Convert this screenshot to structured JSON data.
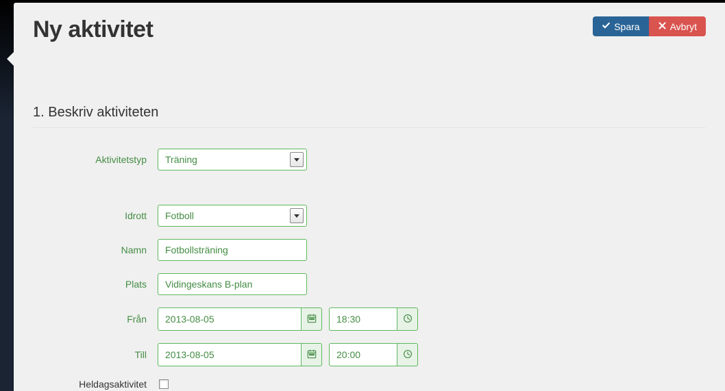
{
  "header": {
    "title": "Ny aktivitet",
    "save_label": "Spara",
    "cancel_label": "Avbryt"
  },
  "section": {
    "title": "1. Beskriv aktiviteten"
  },
  "form": {
    "activity_type": {
      "label": "Aktivitetstyp",
      "value": "Träning"
    },
    "sport": {
      "label": "Idrott",
      "value": "Fotboll"
    },
    "name": {
      "label": "Namn",
      "value": "Fotbollsträning"
    },
    "place": {
      "label": "Plats",
      "value": "Vidingeskans B-plan"
    },
    "from": {
      "label": "Från",
      "date": "2013-08-05",
      "time": "18:30"
    },
    "to": {
      "label": "Till",
      "date": "2013-08-05",
      "time": "20:00"
    },
    "allday": {
      "label": "Heldagsaktivitet",
      "checked": false
    }
  }
}
